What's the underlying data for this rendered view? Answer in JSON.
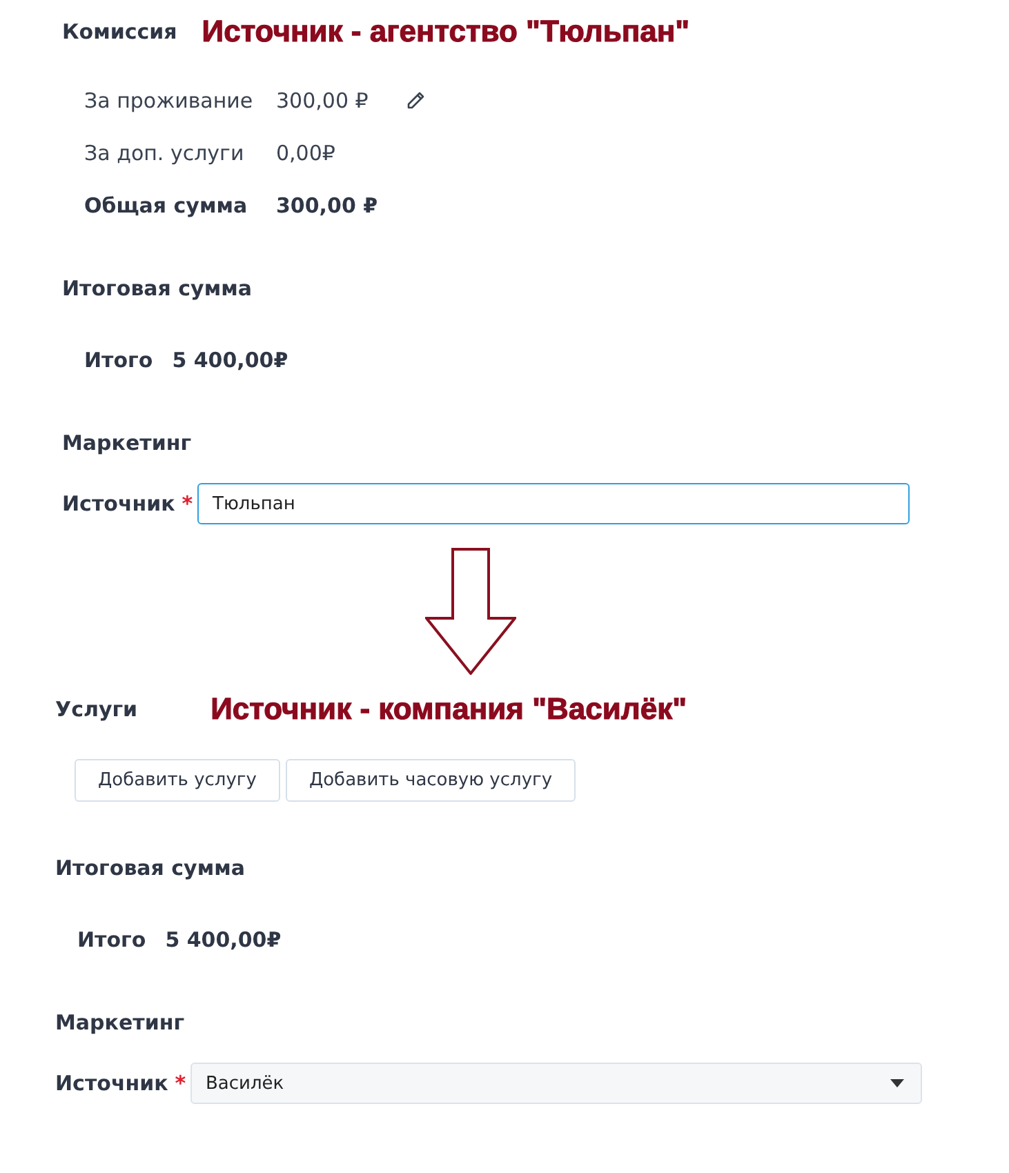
{
  "panels": [
    {
      "heading": "Комиссия",
      "annotation": "Источник - агентство \"Тюльпан\"",
      "commission": [
        {
          "label": "За проживание",
          "value": "300,00 ₽",
          "kind": "item",
          "editable": true
        },
        {
          "label": "За доп. услуги",
          "value": "0,00₽",
          "kind": "item",
          "editable": false
        },
        {
          "label": "Общая сумма",
          "value": "300,00 ₽",
          "kind": "sum",
          "editable": false
        }
      ],
      "total": {
        "heading": "Итоговая сумма",
        "label": "Итого",
        "value": "5 400,00₽"
      },
      "marketing": {
        "heading": "Маркетинг",
        "field": {
          "label": "Источник",
          "required_mark": "*",
          "kind": "text",
          "value": "Тюльпан"
        }
      }
    },
    {
      "heading": "Услуги",
      "annotation": "Источник - компания \"Василёк\"",
      "buttons": [
        "Добавить услугу",
        "Добавить часовую услугу"
      ],
      "total": {
        "heading": "Итоговая сумма",
        "label": "Итого",
        "value": "5 400,00₽"
      },
      "marketing": {
        "heading": "Маркетинг",
        "field": {
          "label": "Источник",
          "required_mark": "*",
          "kind": "select",
          "value": "Василёк"
        }
      }
    }
  ]
}
